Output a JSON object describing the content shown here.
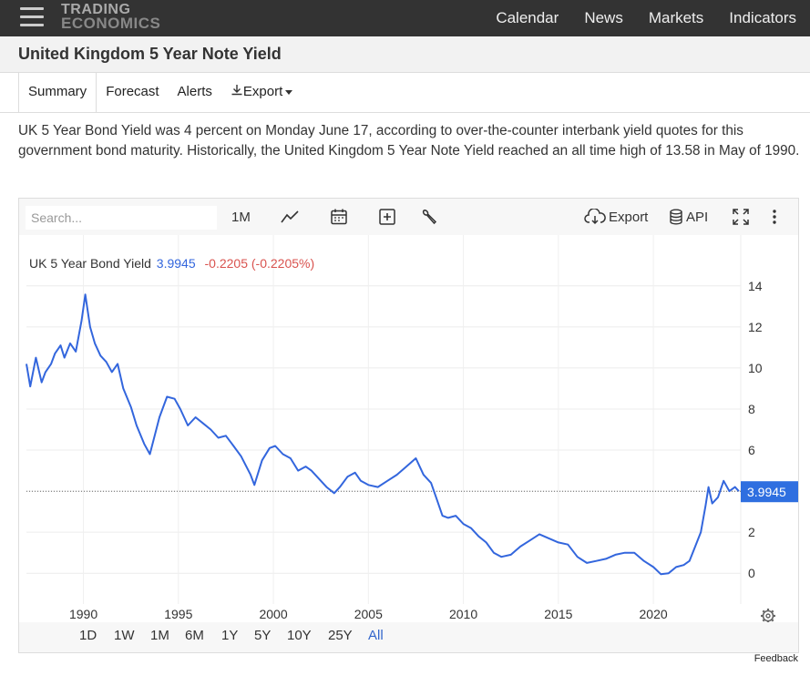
{
  "nav": {
    "logo_line1": "TRADING",
    "logo_line2": "ECONOMICS",
    "links": [
      "Calendar",
      "News",
      "Markets",
      "Indicators"
    ]
  },
  "page": {
    "title": "United Kingdom 5 Year Note Yield",
    "tabs": [
      "Summary",
      "Forecast",
      "Alerts",
      "Export"
    ],
    "description": "UK 5 Year Bond Yield was 4 percent on Monday June 17, according to over-the-counter interbank yield quotes for this government bond maturity. Historically, the United Kingdom 5 Year Note Yield reached an all time high of 13.58 in May of 1990."
  },
  "toolbar": {
    "search_placeholder": "Search...",
    "period": "1M",
    "export": "Export",
    "api": "API"
  },
  "ranges": [
    "1D",
    "1W",
    "1M",
    "6M",
    "1Y",
    "5Y",
    "10Y",
    "25Y",
    "All"
  ],
  "active_range": "All",
  "feedback": "Feedback",
  "colors": {
    "line": "#3366dd",
    "down": "#d9534f",
    "badge": "#2f6fe0"
  },
  "chart_data": {
    "type": "line",
    "series_label": "UK 5 Year Bond Yield",
    "last_value": "3.9945",
    "change": "-0.2205",
    "change_pct": "(-0.2205%)",
    "x_ticks": [
      1990,
      1995,
      2000,
      2005,
      2010,
      2015,
      2020
    ],
    "y_ticks": [
      0,
      2,
      4,
      6,
      8,
      10,
      12,
      14
    ],
    "xlim": [
      1987,
      2024.6
    ],
    "ylim": [
      -1.5,
      15.5
    ],
    "grid": true,
    "current_line": 3.9945,
    "x": [
      1987.0,
      1987.2,
      1987.5,
      1987.8,
      1988.0,
      1988.3,
      1988.5,
      1988.8,
      1989.0,
      1989.3,
      1989.6,
      1989.9,
      1990.1,
      1990.35,
      1990.6,
      1990.9,
      1991.2,
      1991.5,
      1991.8,
      1992.1,
      1992.5,
      1992.8,
      1993.2,
      1993.5,
      1994.0,
      1994.4,
      1994.8,
      1995.1,
      1995.5,
      1995.9,
      1996.3,
      1996.7,
      1997.1,
      1997.5,
      1997.9,
      1998.3,
      1998.8,
      1999.0,
      1999.4,
      1999.8,
      2000.1,
      2000.5,
      2000.9,
      2001.3,
      2001.7,
      2002.0,
      2002.4,
      2002.8,
      2003.2,
      2003.5,
      2003.9,
      2004.3,
      2004.6,
      2005.0,
      2005.5,
      2006.0,
      2006.5,
      2007.0,
      2007.5,
      2007.9,
      2008.3,
      2008.6,
      2008.9,
      2009.2,
      2009.6,
      2010.0,
      2010.4,
      2010.8,
      2011.2,
      2011.6,
      2012.0,
      2012.5,
      2013.0,
      2013.5,
      2014.0,
      2014.5,
      2015.0,
      2015.5,
      2016.0,
      2016.5,
      2017.0,
      2017.5,
      2018.0,
      2018.5,
      2019.0,
      2019.5,
      2020.0,
      2020.4,
      2020.8,
      2021.2,
      2021.6,
      2021.9,
      2022.2,
      2022.5,
      2022.75,
      2022.9,
      2023.1,
      2023.4,
      2023.7,
      2024.0,
      2024.3,
      2024.5
    ],
    "values": [
      10.2,
      9.1,
      10.5,
      9.3,
      9.8,
      10.2,
      10.7,
      11.1,
      10.5,
      11.2,
      10.8,
      12.3,
      13.58,
      12.0,
      11.2,
      10.6,
      10.3,
      9.8,
      10.2,
      9.0,
      8.1,
      7.2,
      6.3,
      5.8,
      7.6,
      8.6,
      8.5,
      8.0,
      7.2,
      7.6,
      7.3,
      7.0,
      6.6,
      6.7,
      6.2,
      5.7,
      4.8,
      4.3,
      5.5,
      6.1,
      6.2,
      5.8,
      5.6,
      5.0,
      5.2,
      5.0,
      4.6,
      4.2,
      3.9,
      4.2,
      4.7,
      4.9,
      4.5,
      4.3,
      4.2,
      4.5,
      4.8,
      5.2,
      5.6,
      4.8,
      4.4,
      3.6,
      2.8,
      2.7,
      2.8,
      2.4,
      2.2,
      1.8,
      1.5,
      1.0,
      0.8,
      0.9,
      1.3,
      1.6,
      1.9,
      1.7,
      1.5,
      1.4,
      0.8,
      0.5,
      0.6,
      0.7,
      0.9,
      1.0,
      1.0,
      0.6,
      0.3,
      -0.05,
      0.0,
      0.3,
      0.4,
      0.6,
      1.3,
      2.0,
      3.3,
      4.2,
      3.4,
      3.7,
      4.5,
      4.0,
      4.2,
      3.9945
    ]
  }
}
